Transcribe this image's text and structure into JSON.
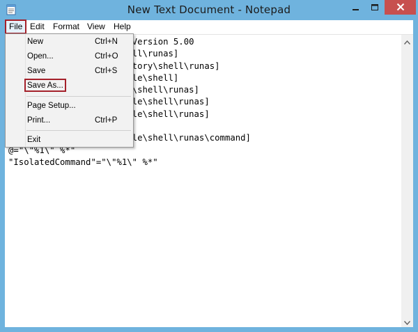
{
  "window": {
    "title": "New Text Document - Notepad"
  },
  "menubar": {
    "items": [
      "File",
      "Edit",
      "Format",
      "View",
      "Help"
    ]
  },
  "editor": {
    "lines": [
      "Windows Registry Editor Version 5.00",
      "[HKEY_CLASSES_ROOT\\*\\shell\\runas]",
      "[HKEY_CLASSES_ROOT\\Directory\\shell\\runas]",
      "[HKEY_CLASSES_ROOT\\dllfile\\shell]",
      "[HKEY_CLASSES_ROOT\\Drive\\shell\\runas]",
      "[HKEY_CLASSES_ROOT\\exefile\\shell\\runas]",
      "[HKEY_CLASSES_ROOT\\dllfile\\shell\\runas]",
      "",
      "[HKEY_CLASSES_ROOT\\exefile\\shell\\runas\\command]",
      "@=\"\\\"%1\\\" %*\"",
      "\"IsolatedCommand\"=\"\\\"%1\\\" %*\""
    ]
  },
  "file_menu": {
    "items": [
      {
        "label": "New",
        "shortcut": "Ctrl+N"
      },
      {
        "label": "Open...",
        "shortcut": "Ctrl+O"
      },
      {
        "label": "Save",
        "shortcut": "Ctrl+S"
      },
      {
        "label": "Save As...",
        "shortcut": ""
      },
      {
        "label": "Page Setup...",
        "shortcut": ""
      },
      {
        "label": "Print...",
        "shortcut": "Ctrl+P"
      },
      {
        "label": "Exit",
        "shortcut": ""
      }
    ]
  },
  "colors": {
    "frame": "#6fb3de",
    "close_button": "#c7504f",
    "highlight_box": "#a4202a"
  },
  "icons": {
    "app": "notepad-icon",
    "minimize": "minimize-icon",
    "maximize": "maximize-icon",
    "close": "close-icon",
    "scroll_up": "chevron-up-icon",
    "scroll_down": "chevron-down-icon"
  }
}
